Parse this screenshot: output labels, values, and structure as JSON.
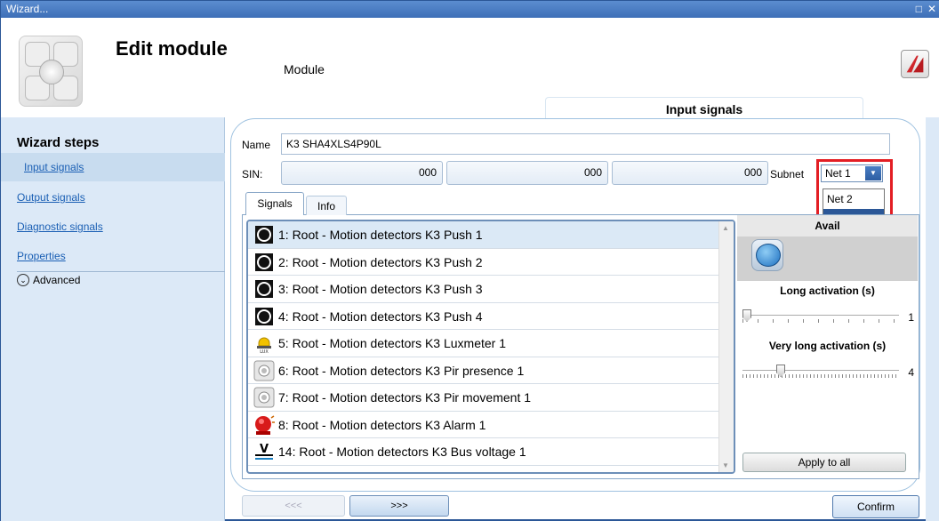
{
  "window": {
    "title": "Wizard...",
    "controls": [
      "□",
      "✕"
    ]
  },
  "header": {
    "title": "Edit module",
    "subtitle": "Module",
    "section_tab": "Input signals"
  },
  "sidebar": {
    "title": "Wizard steps",
    "items": [
      {
        "label": "Input signals",
        "active": true
      },
      {
        "label": "Output signals",
        "active": false
      },
      {
        "label": "Diagnostic signals",
        "active": false
      },
      {
        "label": "Properties",
        "active": false
      }
    ],
    "advanced_label": "Advanced",
    "advanced_icon": "chevron-down-circle"
  },
  "form": {
    "name_label": "Name",
    "name_value": "K3 SHA4XLS4P90L",
    "sin_label": "SIN:",
    "sin_values": [
      "000",
      "000",
      "000"
    ],
    "subnet_label": "Subnet",
    "subnet_value": "Net 1",
    "subnet_options": [
      {
        "label": "Net 2",
        "selected": false
      },
      {
        "label": "Net 1",
        "selected": true
      }
    ]
  },
  "tabs": {
    "signals": "Signals",
    "info": "Info"
  },
  "signals": [
    {
      "label": "1: Root - Motion detectors K3 Push 1",
      "icon": "push-button",
      "selected": true
    },
    {
      "label": "2: Root - Motion detectors K3 Push 2",
      "icon": "push-button",
      "selected": false
    },
    {
      "label": "3: Root - Motion detectors K3 Push 3",
      "icon": "push-button",
      "selected": false
    },
    {
      "label": "4: Root - Motion detectors K3 Push 4",
      "icon": "push-button",
      "selected": false
    },
    {
      "label": "5: Root - Motion detectors K3 Luxmeter 1",
      "icon": "luxmeter",
      "selected": false
    },
    {
      "label": "6: Root - Motion detectors K3 Pir presence 1",
      "icon": "pir-sensor",
      "selected": false
    },
    {
      "label": "7: Root - Motion detectors K3 Pir movement 1",
      "icon": "pir-sensor",
      "selected": false
    },
    {
      "label": "8: Root - Motion detectors K3 Alarm 1",
      "icon": "alarm",
      "selected": false
    },
    {
      "label": "14: Root - Motion detectors K3 Bus voltage 1",
      "icon": "voltage",
      "selected": false
    }
  ],
  "available": {
    "header": "Avail",
    "long_activation_label": "Long activation (s)",
    "long_activation_value": "1",
    "very_long_activation_label": "Very long activation (s)",
    "very_long_activation_value": "4",
    "apply_label": "Apply to all"
  },
  "nav": {
    "prev_label": "<<<",
    "next_label": ">>>",
    "confirm_label": "Confirm"
  },
  "colors": {
    "accent": "#2b5797",
    "highlight": "#e31e24",
    "sidebar_bg": "#dce9f7"
  }
}
